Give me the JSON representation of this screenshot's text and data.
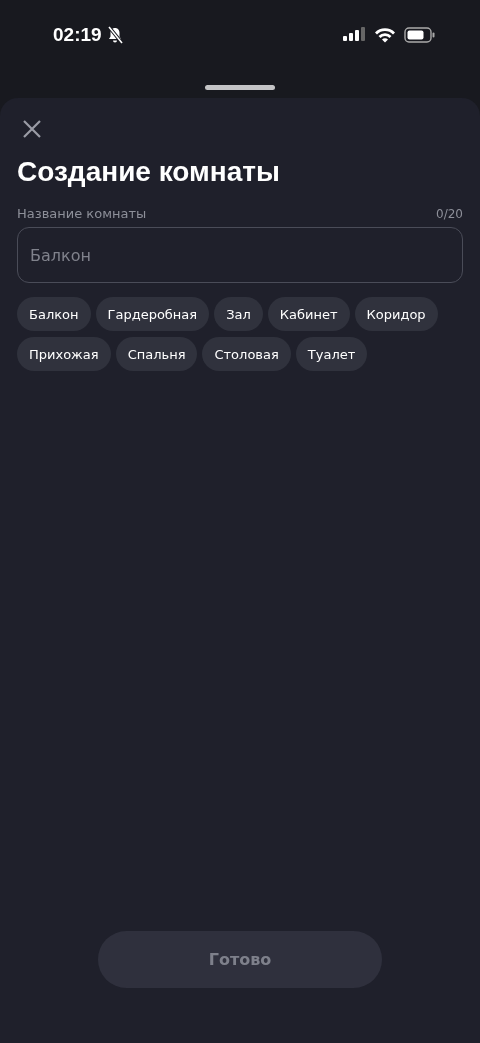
{
  "status_bar": {
    "time": "02:19",
    "silent": true
  },
  "sheet": {
    "title": "Создание комнаты",
    "field": {
      "label": "Название комнаты",
      "counter": "0/20",
      "placeholder": "Балкон"
    },
    "suggestions": [
      "Балкон",
      "Гардеробная",
      "Зал",
      "Кабинет",
      "Коридор",
      "Прихожая",
      "Спальня",
      "Столовая",
      "Туалет"
    ],
    "done_button": {
      "label": "Готово",
      "disabled": true
    }
  }
}
